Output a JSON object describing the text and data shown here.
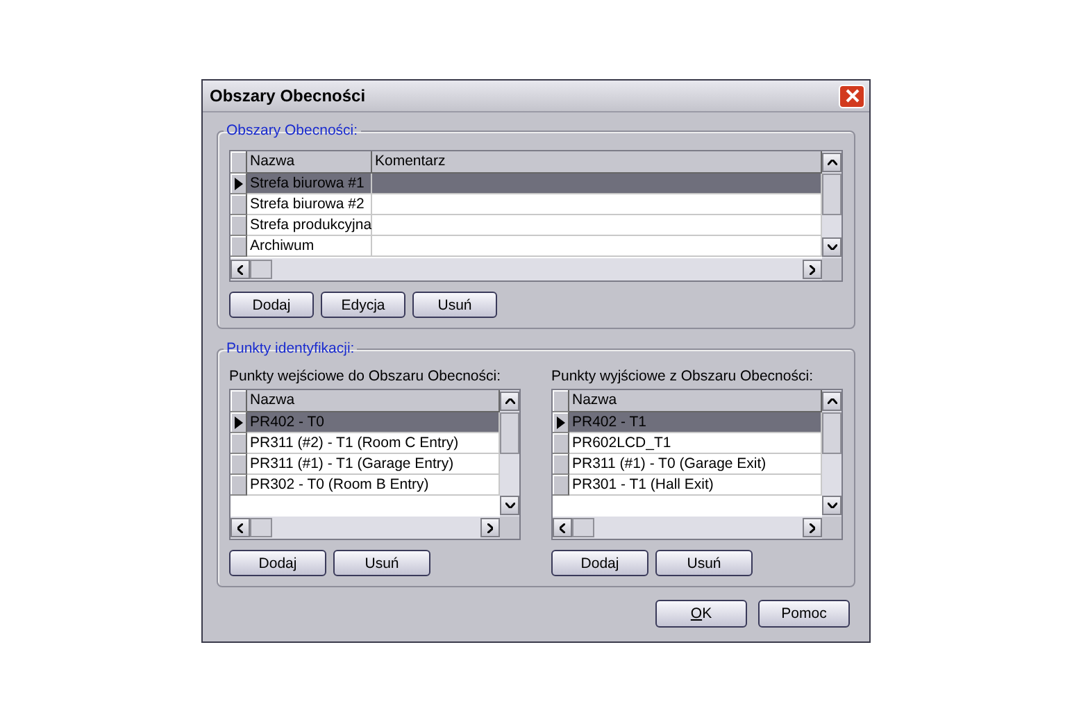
{
  "window": {
    "title": "Obszary Obecności"
  },
  "areas": {
    "legend": "Obszary Obecności:",
    "columns": [
      "Nazwa",
      "Komentarz"
    ],
    "rows": [
      {
        "name": "Strefa biurowa #1",
        "selected": true
      },
      {
        "name": "Strefa biurowa #2",
        "selected": false
      },
      {
        "name": "Strefa produkcyjna",
        "selected": false
      },
      {
        "name": "Archiwum",
        "selected": false
      }
    ],
    "buttons": [
      "Dodaj",
      "Edycja",
      "Usuń"
    ]
  },
  "identification": {
    "legend": "Punkty identyfikacji:",
    "lists": [
      {
        "label": "Punkty wejściowe do Obszaru Obecności:",
        "columns": [
          "Nazwa"
        ],
        "rows": [
          {
            "name": "PR402 - T0",
            "selected": true
          },
          {
            "name": "PR311 (#2) - T1 (Room C Entry)",
            "selected": false
          },
          {
            "name": "PR311 (#1) - T1 (Garage Entry)",
            "selected": false
          },
          {
            "name": "PR302 - T0 (Room B Entry)",
            "selected": false
          }
        ],
        "buttons": [
          "Dodaj",
          "Usuń"
        ]
      },
      {
        "label": "Punkty wyjściowe z Obszaru Obecności:",
        "columns": [
          "Nazwa"
        ],
        "rows": [
          {
            "name": "PR402 - T1",
            "selected": true
          },
          {
            "name": "PR602LCD_T1",
            "selected": false
          },
          {
            "name": "PR311 (#1) - T0 (Garage Exit)",
            "selected": false
          },
          {
            "name": "PR301 - T1 (Hall Exit)",
            "selected": false
          }
        ],
        "buttons": [
          "Dodaj",
          "Usuń"
        ]
      }
    ]
  },
  "footer_buttons": [
    {
      "label": "OK",
      "access_key": true
    },
    {
      "label": "Pomoc"
    }
  ]
}
